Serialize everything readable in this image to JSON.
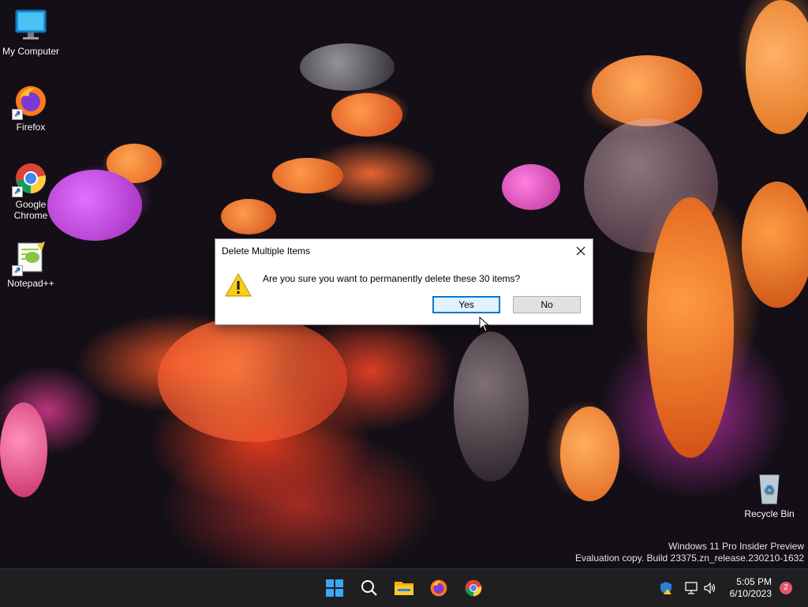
{
  "desktop": {
    "icons": [
      {
        "label": "My Computer"
      },
      {
        "label": "Firefox"
      },
      {
        "label": "Google Chrome"
      },
      {
        "label": "Notepad++"
      },
      {
        "label": "Recycle Bin"
      }
    ],
    "watermark": {
      "line1": "Windows 11 Pro Insider Preview",
      "line2": "Evaluation copy. Build 23375.zn_release.230210-1632"
    }
  },
  "dialog": {
    "title": "Delete Multiple Items",
    "message": "Are you sure you want to permanently delete these 30 items?",
    "yes_label": "Yes",
    "no_label": "No",
    "icon": "warning-icon"
  },
  "taskbar": {
    "items": [
      "start-icon",
      "search-icon",
      "file-explorer-icon",
      "firefox-icon",
      "chrome-icon"
    ],
    "tray": [
      "security-icon",
      "network-icon",
      "volume-icon"
    ],
    "time": "5:05 PM",
    "date": "6/10/2023",
    "notification_count": "2"
  },
  "colors": {
    "accent": "#0078d7",
    "taskbar": "#1f1f22",
    "dialog_bg": "#f0f0f0",
    "badge": "#e0566b"
  }
}
